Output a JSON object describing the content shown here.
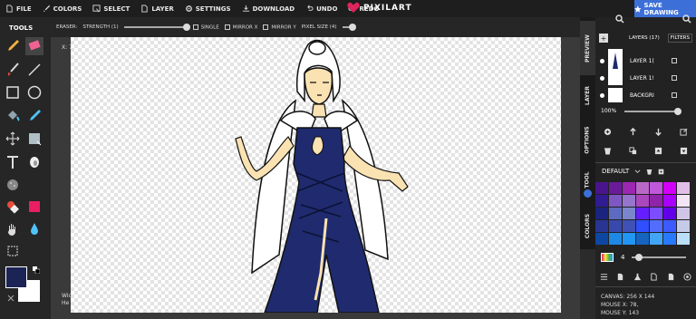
{
  "menu": [
    {
      "label": "FILE",
      "icon": "file-icon"
    },
    {
      "label": "COLORS",
      "icon": "brush-icon"
    },
    {
      "label": "SELECT",
      "icon": "select-icon"
    },
    {
      "label": "LAYER",
      "icon": "layer-icon"
    },
    {
      "label": "SETTINGS",
      "icon": "gear-icon"
    },
    {
      "label": "DOWNLOAD",
      "icon": "download-icon"
    },
    {
      "label": "UNDO",
      "icon": "undo-icon"
    },
    {
      "label": "REDO",
      "icon": "redo-icon"
    }
  ],
  "brand": {
    "name": "PIXILART",
    "color": "#e0245e"
  },
  "save_label": "SAVE DRAWING",
  "tool_options": {
    "tool_name": "ERASER:",
    "strength": "STRENGTH (1)",
    "single": "SINGLE",
    "mirror_x": "MIRROR X",
    "mirror_y": "MIRROR Y",
    "pixel_size": "PIXEL SIZE (4)"
  },
  "tools_title": "TOOLS",
  "colors": {
    "primary": "#1c2456",
    "secondary": "#ffffff",
    "accent": "#3d6fd8"
  },
  "canvas_overlay": {
    "coord": "X: 7",
    "hint_line1": "Wid",
    "hint_line2": "He"
  },
  "side_tabs": [
    "PREVIEW",
    "LAYER",
    "OPTIONS",
    "TOOL",
    "COLORS"
  ],
  "layers": {
    "title": "LAYERS (17)",
    "filters": "FILTERS",
    "items": [
      {
        "name": "LAYER 1("
      },
      {
        "name": "LAYER 1!"
      },
      {
        "name": "BACKGRI"
      }
    ]
  },
  "zoom": "100%",
  "palette": {
    "name": "DEFAULT",
    "colors": [
      "#4a148c",
      "#6a1b9a",
      "#9c27b0",
      "#ba68c8",
      "#c158dc",
      "#d500f9",
      "#e1bee7",
      "#311b92",
      "#7e57c2",
      "#9575cd",
      "#ab47bc",
      "#8e24aa",
      "#aa00ff",
      "#f3e5f5",
      "#1a237e",
      "#5c6bc0",
      "#7986cb",
      "#651fff",
      "#7c4dff",
      "#6200ea",
      "#d1c4e9",
      "#283593",
      "#3949ab",
      "#3f51b5",
      "#304ffe",
      "#536dfe",
      "#3d5afe",
      "#c5cae9",
      "#0d47a1",
      "#1e88e5",
      "#2196f3",
      "#1565c0",
      "#42a5f5",
      "#2979ff",
      "#bbdefb"
    ]
  },
  "brush_size": "4",
  "status": {
    "canvas": "CANVAS: 256 X 144",
    "mouse_x": "MOUSE X: 78,",
    "mouse_y": "MOUSE Y: 143"
  }
}
